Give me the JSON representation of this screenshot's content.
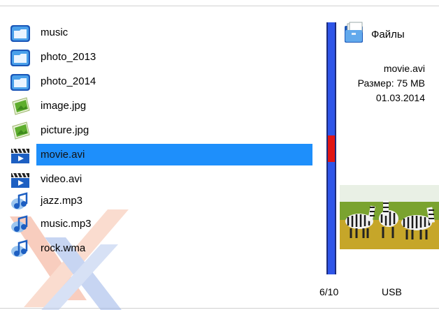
{
  "files": [
    {
      "name": "music",
      "icon": "folder-icon"
    },
    {
      "name": "photo_2013",
      "icon": "folder-icon"
    },
    {
      "name": "photo_2014",
      "icon": "folder-icon"
    },
    {
      "name": "image.jpg",
      "icon": "image-file-icon"
    },
    {
      "name": "picture.jpg",
      "icon": "image-file-icon"
    },
    {
      "name": "movie.avi",
      "icon": "video-file-icon",
      "selected": true
    },
    {
      "name": "video.avi",
      "icon": "video-file-icon"
    },
    {
      "name": "jazz.mp3",
      "icon": "audio-file-icon"
    },
    {
      "name": "music.mp3",
      "icon": "audio-file-icon"
    },
    {
      "name": "rock.wma",
      "icon": "audio-file-icon"
    }
  ],
  "panel": {
    "title": "Файлы",
    "title_icon": "files-folder-icon",
    "file_name": "movie.avi",
    "file_size": "Размер: 75 MB",
    "file_date": "01.03.2014",
    "preview_icon": "zebra-preview-thumbnail"
  },
  "scroll": {
    "position": 6,
    "total": 10
  },
  "footer": {
    "count": "6/10",
    "source": "USB"
  },
  "colors": {
    "selection": "#1e8ffb",
    "scrollbar": "#2f55e8",
    "scroll_thumb": "#e01515"
  }
}
